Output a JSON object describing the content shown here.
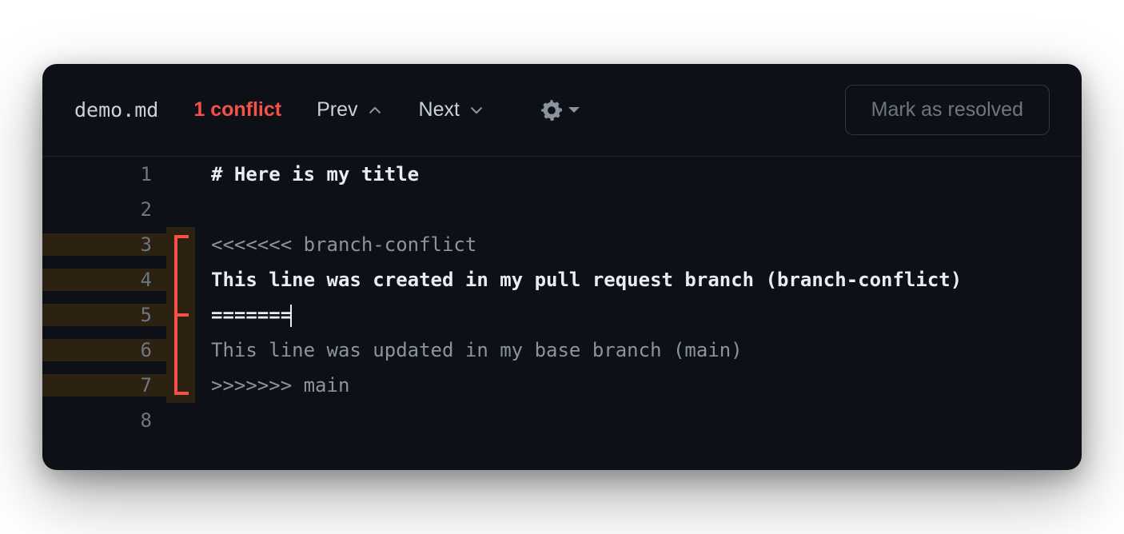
{
  "toolbar": {
    "filename": "demo.md",
    "conflict_count_label": "1 conflict",
    "prev_label": "Prev",
    "next_label": "Next",
    "resolve_label": "Mark as resolved"
  },
  "editor": {
    "lines": [
      {
        "n": "1",
        "text": "# Here is my title",
        "style": "heading",
        "conflict": false,
        "bracket": ""
      },
      {
        "n": "2",
        "text": "",
        "style": "",
        "conflict": false,
        "bracket": ""
      },
      {
        "n": "3",
        "text": "<<<<<<< branch-conflict",
        "style": "",
        "conflict": true,
        "bracket": "top"
      },
      {
        "n": "4",
        "text": "This line was created in my pull request branch (branch-conflict)",
        "style": "bold",
        "conflict": true,
        "bracket": "mid"
      },
      {
        "n": "5",
        "text": "=======",
        "style": "bold",
        "conflict": true,
        "bracket": "mid-tick",
        "cursor": true
      },
      {
        "n": "6",
        "text": "This line was updated in my base branch (main)",
        "style": "",
        "conflict": true,
        "bracket": "mid"
      },
      {
        "n": "7",
        "text": ">>>>>>> main",
        "style": "",
        "conflict": true,
        "bracket": "bot"
      },
      {
        "n": "8",
        "text": "",
        "style": "",
        "conflict": false,
        "bracket": ""
      }
    ]
  }
}
